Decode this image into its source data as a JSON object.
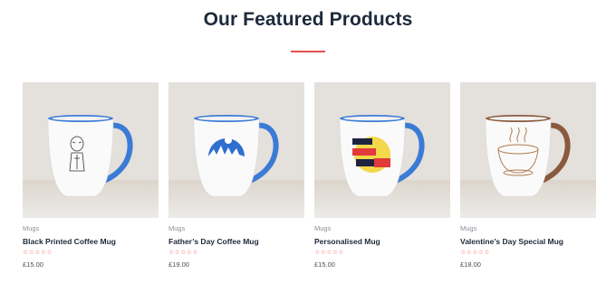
{
  "section": {
    "title": "Our Featured Products"
  },
  "products": [
    {
      "category": "Mugs",
      "name": "Black Printed Coffee Mug",
      "rating": "☆☆☆☆☆",
      "price": "£15.00",
      "design": "sketch-figure",
      "accent": "#3b7bd6"
    },
    {
      "category": "Mugs",
      "name": "Father’s Day Coffee Mug",
      "rating": "☆☆☆☆☆",
      "price": "£19.00",
      "design": "blue-forest-circle",
      "accent": "#3b7bd6"
    },
    {
      "category": "Mugs",
      "name": "Personalised Mug",
      "rating": "☆☆☆☆☆",
      "price": "£15.00",
      "design": "you-wake-me-up",
      "accent": "#3b7bd6"
    },
    {
      "category": "Mugs",
      "name": "Valentine’s Day Special Mug",
      "rating": "☆☆☆☆☆",
      "price": "£18.00",
      "design": "good-morning-coffee",
      "accent": "#8a5a3c"
    }
  ],
  "colors": {
    "title": "#1d2a3b",
    "underline": "#e4504f",
    "stars": "#e4504f"
  }
}
